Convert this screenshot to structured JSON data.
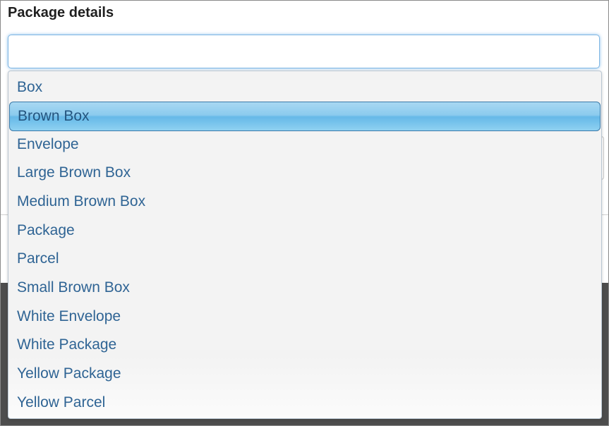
{
  "field": {
    "label": "Package details",
    "value": "",
    "placeholder": ""
  },
  "dropdown": {
    "selected_index": 1,
    "options": [
      {
        "label": "Box"
      },
      {
        "label": "Brown Box"
      },
      {
        "label": "Envelope"
      },
      {
        "label": "Large Brown Box"
      },
      {
        "label": "Medium Brown Box"
      },
      {
        "label": "Package"
      },
      {
        "label": "Parcel"
      },
      {
        "label": "Small Brown Box"
      },
      {
        "label": "White Envelope"
      },
      {
        "label": "White Package"
      },
      {
        "label": "Yellow Package"
      },
      {
        "label": "Yellow Parcel"
      }
    ]
  },
  "colors": {
    "option_text": "#2f6494",
    "highlight": "#8ccbee",
    "focus_ring": "#7fb6e3"
  }
}
